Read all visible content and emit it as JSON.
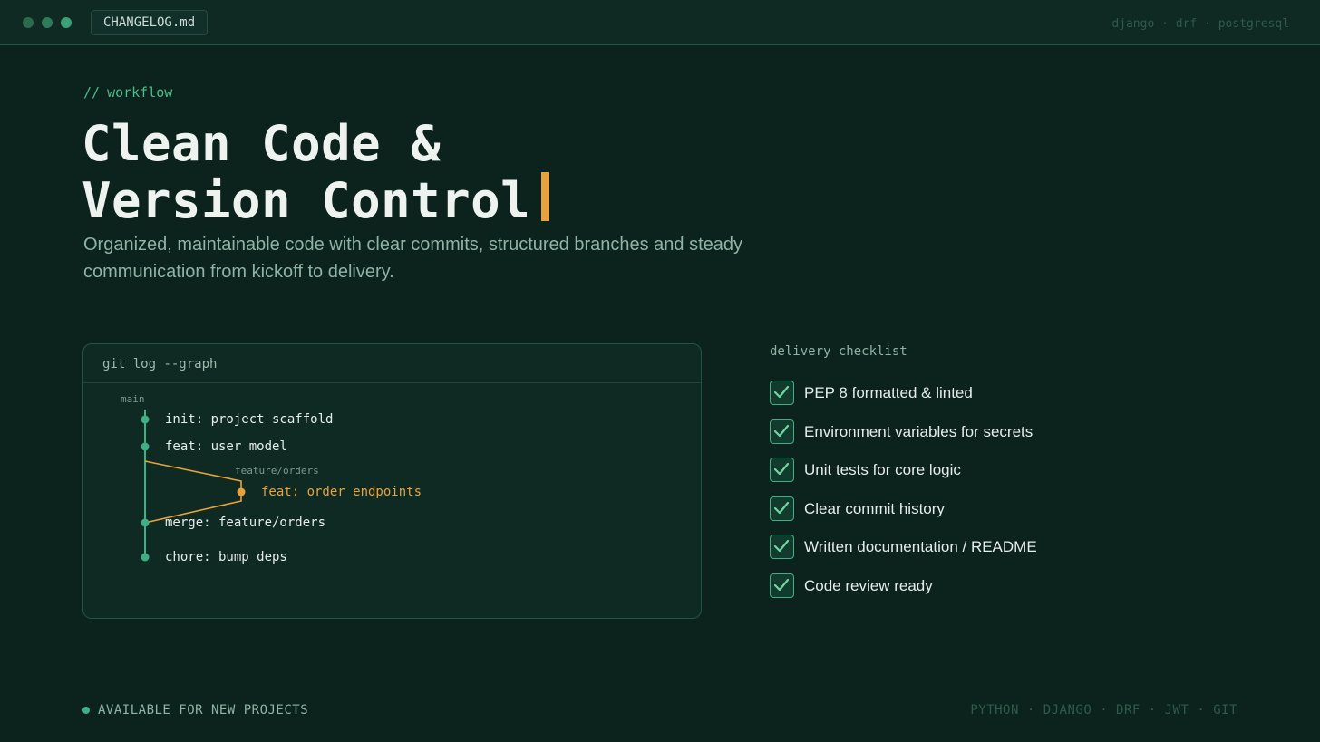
{
  "window": {
    "tab_label": "CHANGELOG.md",
    "stack_top": "django · drf · postgresql"
  },
  "hero": {
    "eyebrow_prefix": "//",
    "eyebrow": "workflow",
    "title_line1": "Clean Code &",
    "title_line2": "Version Control",
    "subtitle": "Organized, maintainable code with clear commits, structured branches and steady communication from kickoff to delivery."
  },
  "git": {
    "header": "git log --graph",
    "branch_main": "main",
    "branch_feature": "feature/orders",
    "commits": [
      {
        "label": "init: project scaffold",
        "branch": "main"
      },
      {
        "label": "feat: user model",
        "branch": "main"
      },
      {
        "label": "feat: order endpoints",
        "branch": "feature"
      },
      {
        "label": "merge: feature/orders",
        "branch": "main"
      },
      {
        "label": "chore: bump deps",
        "branch": "main"
      }
    ]
  },
  "checklist": {
    "title": "delivery checklist",
    "items": [
      {
        "label": "PEP 8 formatted & linted",
        "checked": true
      },
      {
        "label": "Environment variables for secrets",
        "checked": true
      },
      {
        "label": "Unit tests for core logic",
        "checked": true
      },
      {
        "label": "Clear commit history",
        "checked": true
      },
      {
        "label": "Written documentation / README",
        "checked": true
      },
      {
        "label": "Code review ready",
        "checked": true
      }
    ]
  },
  "footer": {
    "availability": "AVAILABLE FOR NEW PROJECTS",
    "stack": "PYTHON · DJANGO · DRF · JWT · GIT"
  },
  "colors": {
    "background": "#0b231c",
    "accent_green": "#3fb083",
    "accent_orange": "#e9a23b"
  }
}
